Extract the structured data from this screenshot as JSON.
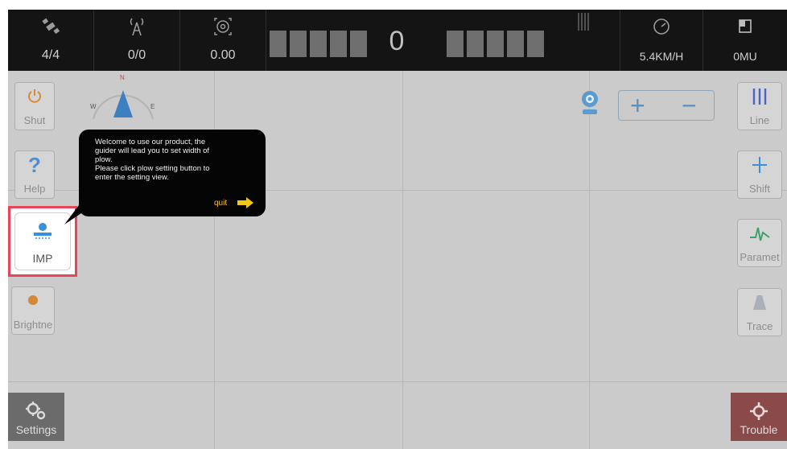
{
  "status_bar": {
    "satellites": "4/4",
    "signal": "0/0",
    "accuracy": "0.00",
    "lightbar_value": "0",
    "speed": "5.4KM/H",
    "area": "0MU"
  },
  "left_buttons": {
    "shut": "Shut",
    "help": "Help",
    "imp": "IMP",
    "brightness": "Brightne",
    "settings": "Settings"
  },
  "right_buttons": {
    "line": "Line",
    "shift": "Shift",
    "param": "Paramet",
    "trace": "Trace",
    "trouble": "Trouble"
  },
  "compass": {
    "n": "N",
    "w": "W",
    "e": "E"
  },
  "tooltip": {
    "line1": "Welcome to use our product, the",
    "line2": "guider will lead you to set width of",
    "line3": "plow.",
    "line4": "Please click plow setting button to",
    "line5": "enter the setting view.",
    "quit": "quit"
  },
  "zoom": {
    "plus": "+",
    "minus": "−"
  },
  "colors": {
    "status_bg": "#141414",
    "map_bg": "#cbcbcb",
    "highlight": "#e8455a",
    "accent_blue": "#5e8fb8",
    "trouble_bg": "#8a4a4a"
  }
}
